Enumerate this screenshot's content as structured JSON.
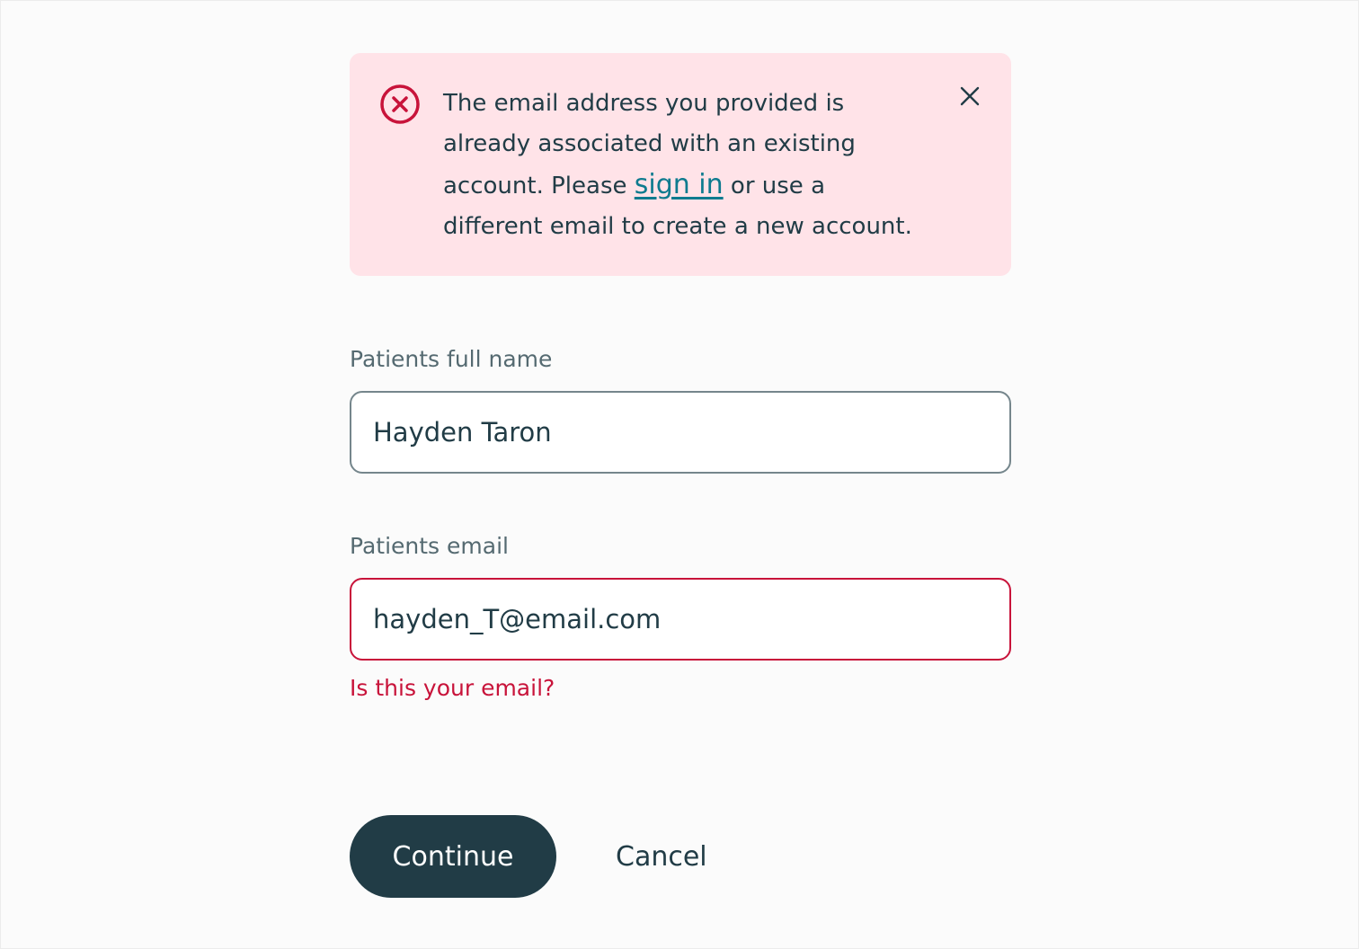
{
  "colors": {
    "background": "#fbfbfb",
    "alert_background": "#ffe3e8",
    "error": "#c8133a",
    "link": "#0e7b8f",
    "text": "#213c46",
    "primary_button": "#213c46"
  },
  "alert": {
    "icon": "error-circle-x-icon",
    "close_icon": "close-icon",
    "message_before_link": "The email address you provided is already associated with an existing account. Please ",
    "link_text": "sign in",
    "message_after_link": " or use a different email to create a new account."
  },
  "form": {
    "name_field": {
      "label": "Patients full name",
      "value": "Hayden Taron"
    },
    "email_field": {
      "label": "Patients email",
      "value": "hayden_T@email.com",
      "error_message": "Is this your email?"
    }
  },
  "actions": {
    "continue_label": "Continue",
    "cancel_label": "Cancel"
  }
}
